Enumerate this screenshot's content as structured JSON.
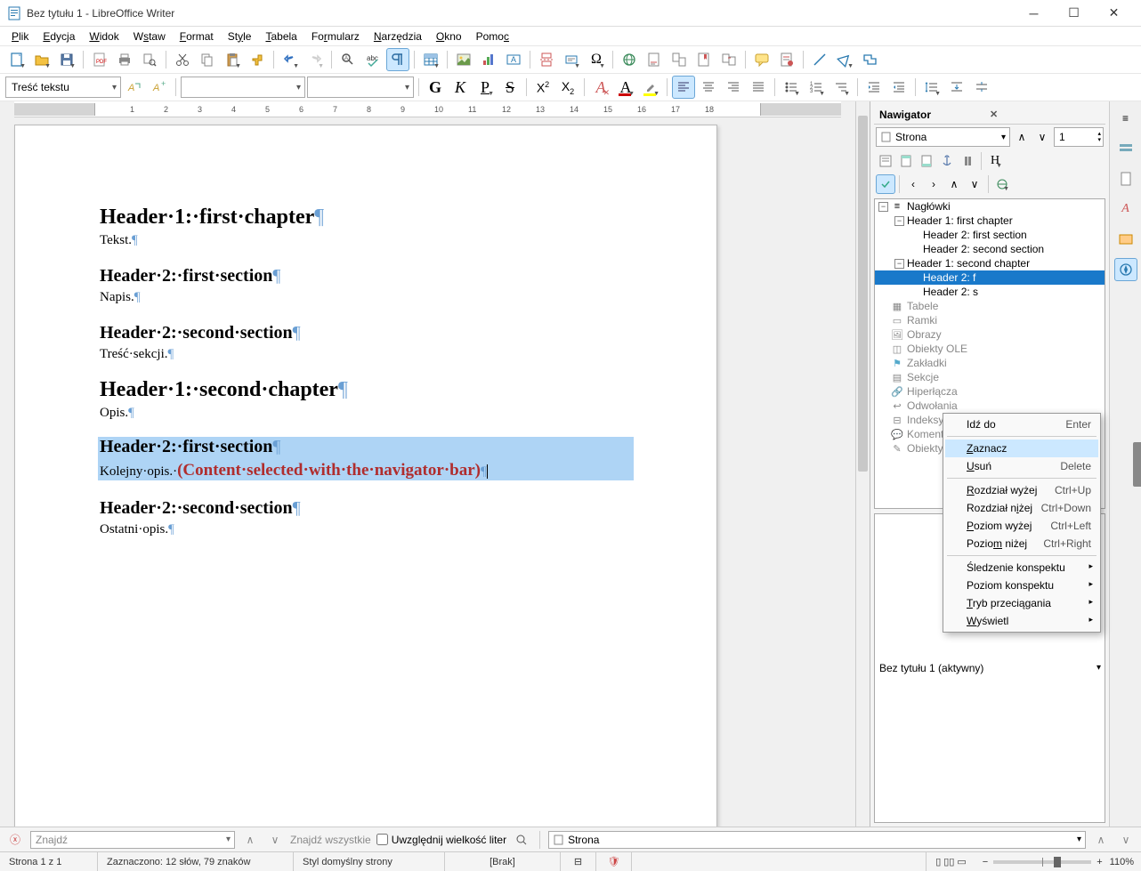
{
  "window": {
    "title": "Bez tytułu 1 - LibreOffice Writer"
  },
  "menu": [
    "Plik",
    "Edycja",
    "Widok",
    "Wstaw",
    "Format",
    "Style",
    "Tabela",
    "Formularz",
    "Narzędzia",
    "Okno",
    "Pomoc"
  ],
  "style_combo": "Treść tekstu",
  "font_combo": "",
  "size_combo": "",
  "doc": {
    "h1a": "Header·1:·first·chapter",
    "p1": "Tekst.",
    "h2a": "Header·2:·first·section",
    "p2": "Napis.",
    "h2b": "Header·2:·second·section",
    "p3": "Treść·sekcji.",
    "h1b": "Header·1:·second·chapter",
    "p4": "Opis.",
    "h2c": "Header·2:·first·section",
    "p5a": "Kolejny·opis.·",
    "annot": "(Content·selected·with·the·navigator·bar)",
    "h2d": "Header·2:·second·section",
    "p6": "Ostatni·opis."
  },
  "navigator": {
    "title": "Nawigator",
    "goto_combo": "Strona",
    "page_spin": "1",
    "tree": {
      "root": "Nagłówki",
      "h1a": "Header 1: first chapter",
      "h2a": "Header 2: first section",
      "h2b": "Header 2: second section",
      "h1b": "Header 1: second chapter",
      "h2c": "Header 2: f",
      "h2d": "Header 2: s",
      "tables": "Tabele",
      "frames": "Ramki",
      "images": "Obrazy",
      "ole": "Obiekty OLE",
      "bookmarks": "Zakładki",
      "sections": "Sekcje",
      "links": "Hiperłącza",
      "refs": "Odwołania",
      "indexes": "Indeksy",
      "comments": "Komentarze",
      "drawings": "Obiekty rysunko"
    },
    "doc_combo": "Bez tytułu 1 (aktywny)"
  },
  "ctx": {
    "goto": "Idź do",
    "goto_sc": "Enter",
    "select": "Zaznacz",
    "delete": "Usuń",
    "delete_sc": "Delete",
    "chap_up": "Rozdział wyżej",
    "chap_up_sc": "Ctrl+Up",
    "chap_dn": "Rozdział niżej",
    "chap_dn_sc": "Ctrl+Down",
    "lvl_up": "Poziom wyżej",
    "lvl_up_sc": "Ctrl+Left",
    "lvl_dn": "Poziom niżej",
    "lvl_dn_sc": "Ctrl+Right",
    "outline_track": "Śledzenie konspektu",
    "outline_lvl": "Poziom konspektu",
    "drag_mode": "Tryb przeciągania",
    "display": "Wyświetl"
  },
  "findbar": {
    "placeholder": "Znajdź",
    "find_all": "Znajdź wszystkie",
    "match_case": "Uwzględnij wielkość liter",
    "nav_combo": "Strona"
  },
  "status": {
    "page": "Strona 1 z 1",
    "sel": "Zaznaczono: 12 słów, 79 znaków",
    "style": "Styl domyślny strony",
    "lang": "[Brak]",
    "zoom": "110%"
  },
  "ruler_ticks": [
    "1",
    "2",
    "3",
    "4",
    "5",
    "6",
    "7",
    "8",
    "9",
    "10",
    "11",
    "12",
    "13",
    "14",
    "15",
    "16",
    "17",
    "18"
  ]
}
